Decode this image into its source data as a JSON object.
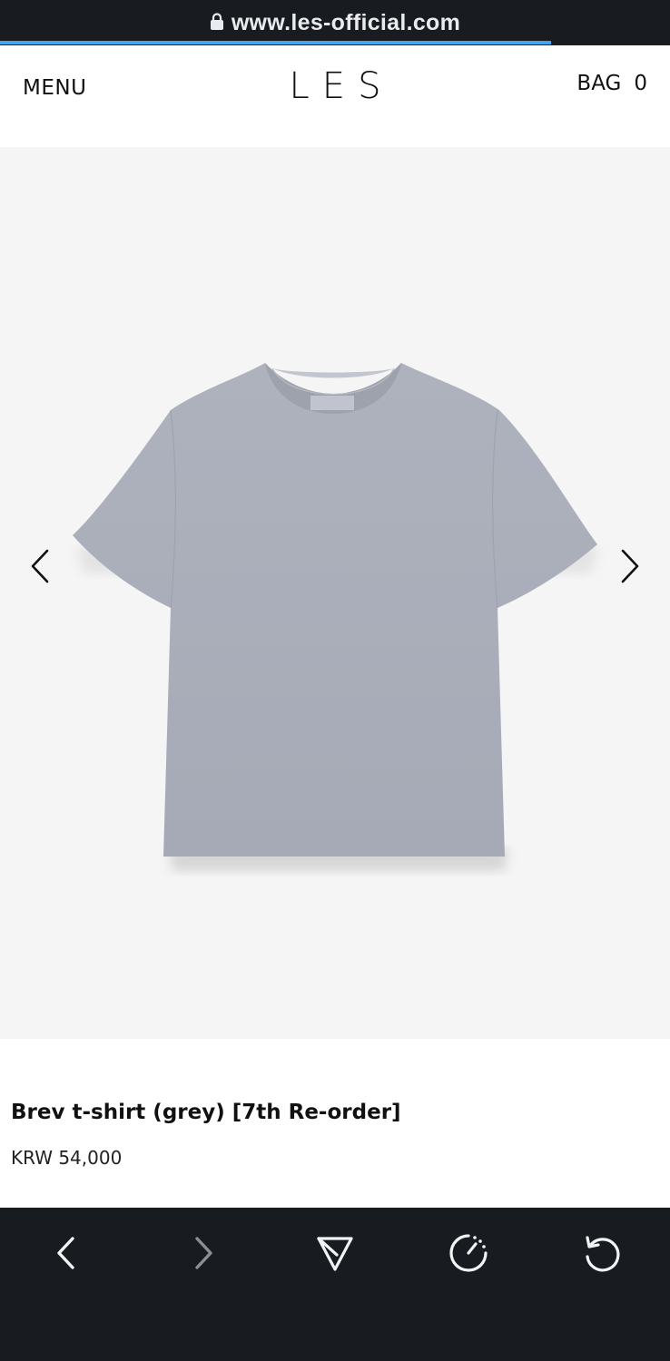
{
  "browser": {
    "url": "www.les-official.com",
    "load_progress": 0.823,
    "toolbar": {
      "back_icon": "chevron-left-icon",
      "forward_icon": "chevron-right-icon",
      "share_icon": "send-icon",
      "timer_icon": "timer-icon",
      "reload_icon": "reload-icon"
    }
  },
  "header": {
    "menu_label": "MENU",
    "brand": "LES",
    "bag_label": "BAG",
    "bag_count": "0"
  },
  "gallery": {
    "prev_icon": "chevron-left-icon",
    "next_icon": "chevron-right-icon"
  },
  "product": {
    "title": "Brev t-shirt (grey) [7th Re-order]",
    "price": "KRW 54,000"
  },
  "colors": {
    "browser_chrome": "#181b1f",
    "progress": "#46a3ef",
    "gallery_bg": "#f5f5f5",
    "shirt": "#a9adb8"
  }
}
